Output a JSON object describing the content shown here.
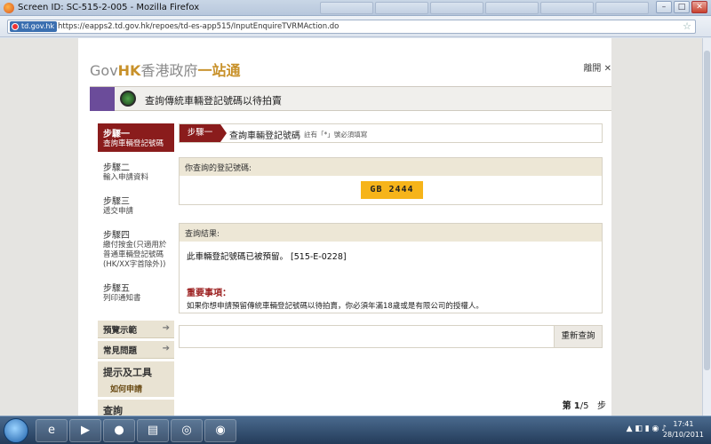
{
  "window": {
    "title": "Screen ID: SC-515-2-005 - Mozilla Firefox",
    "min": "–",
    "max": "□",
    "close": "✕",
    "tabs": [
      "",
      "",
      "",
      "",
      "",
      ""
    ]
  },
  "address": {
    "site": "td.gov.hk",
    "url": "https://eapps2.td.gov.hk/repoes/td-es-app515/InputEnquireTVRMAction.do",
    "bookmark_glyph": "☆"
  },
  "header": {
    "logo_gov": "Gov",
    "logo_hk": "HK",
    "logo_cn": "香港政府",
    "logo_cn2": "一站通",
    "close_label": "離開 ✕",
    "banner_title": "查詢傳統車輛登記號碼以待拍賣"
  },
  "sidebar": {
    "steps": [
      {
        "t1": "步驟一",
        "t2": "查詢車輛登記號碼"
      },
      {
        "t1": "步驟二",
        "t2": "輸入申請資料"
      },
      {
        "t1": "步驟三",
        "t2": "遞交申請"
      },
      {
        "t1": "步驟四",
        "t2": "繳付按金(只適用於普通車輛登記號碼(HK/XX字首除外))"
      },
      {
        "t1": "步驟五",
        "t2": "列印通知書"
      }
    ],
    "preview": "預覽示範",
    "faq": "常見問題",
    "arrow": "➔",
    "tools_title": "提示及工具",
    "tools_link": "如何申請",
    "query": "查詢"
  },
  "main": {
    "step_label": "步驟一",
    "step_title": "查詢車輛登記號碼",
    "step_note": "註有「*」號必須填寫",
    "queried_label": "你查詢的登記號碼:",
    "plate": "GB 2444",
    "result_label": "查詢結果:",
    "result_msg": "此車輛登記號碼已被預留。 [515-E-0228]",
    "important_title": "重要事項：",
    "important_text": "如果你想申請預留傳統車輛登記號碼以待拍賣，你必須年滿18歲或是有限公司的授權人。",
    "requery_button": "重新查詢",
    "pager_prefix": "第",
    "pager_current": "1",
    "pager_total": "/5",
    "pager_suffix": "步"
  },
  "taskbar": {
    "time": "17:41",
    "date": "28/10/2011",
    "tray": "▲ ◧ ▮ ◉ ♪"
  }
}
